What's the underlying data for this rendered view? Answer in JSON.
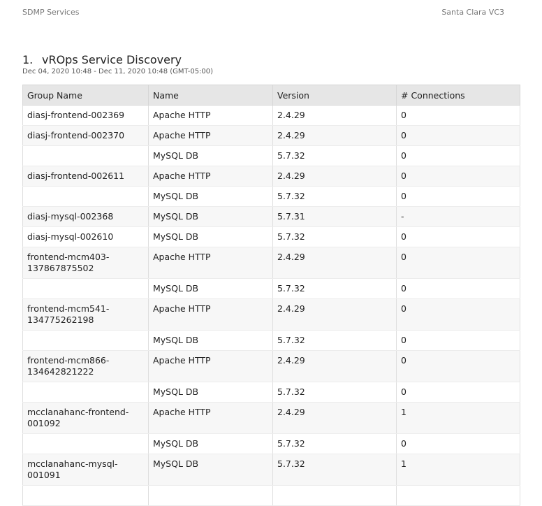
{
  "header": {
    "left": "SDMP Services",
    "right": "Santa Clara VC3"
  },
  "section": {
    "number": "1.",
    "title": "vROps Service Discovery",
    "date_range": "Dec 04, 2020 10:48 - Dec 11, 2020 10:48 (GMT-05:00)"
  },
  "table": {
    "columns": [
      "Group Name",
      "Name",
      "Version",
      "# Connections"
    ],
    "rows": [
      [
        "diasj-frontend-002369",
        "Apache HTTP",
        "2.4.29",
        "0"
      ],
      [
        "diasj-frontend-002370",
        "Apache HTTP",
        "2.4.29",
        "0"
      ],
      [
        "",
        "MySQL DB",
        "5.7.32",
        "0"
      ],
      [
        "diasj-frontend-002611",
        "Apache HTTP",
        "2.4.29",
        "0"
      ],
      [
        "",
        "MySQL DB",
        "5.7.32",
        "0"
      ],
      [
        "diasj-mysql-002368",
        "MySQL DB",
        "5.7.31",
        "-"
      ],
      [
        "diasj-mysql-002610",
        "MySQL DB",
        "5.7.32",
        "0"
      ],
      [
        "frontend-mcm403-137867875502",
        "Apache HTTP",
        "2.4.29",
        "0"
      ],
      [
        "",
        "MySQL DB",
        "5.7.32",
        "0"
      ],
      [
        "frontend-mcm541-134775262198",
        "Apache HTTP",
        "2.4.29",
        "0"
      ],
      [
        "",
        "MySQL DB",
        "5.7.32",
        "0"
      ],
      [
        "frontend-mcm866-134642821222",
        "Apache HTTP",
        "2.4.29",
        "0"
      ],
      [
        "",
        "MySQL DB",
        "5.7.32",
        "0"
      ],
      [
        "mcclanahanc-frontend-001092",
        "Apache HTTP",
        "2.4.29",
        "1"
      ],
      [
        "",
        "MySQL DB",
        "5.7.32",
        "0"
      ],
      [
        "mcclanahanc-mysql-001091",
        "MySQL DB",
        "5.7.32",
        "1"
      ],
      [
        "",
        "",
        "",
        ""
      ]
    ]
  }
}
